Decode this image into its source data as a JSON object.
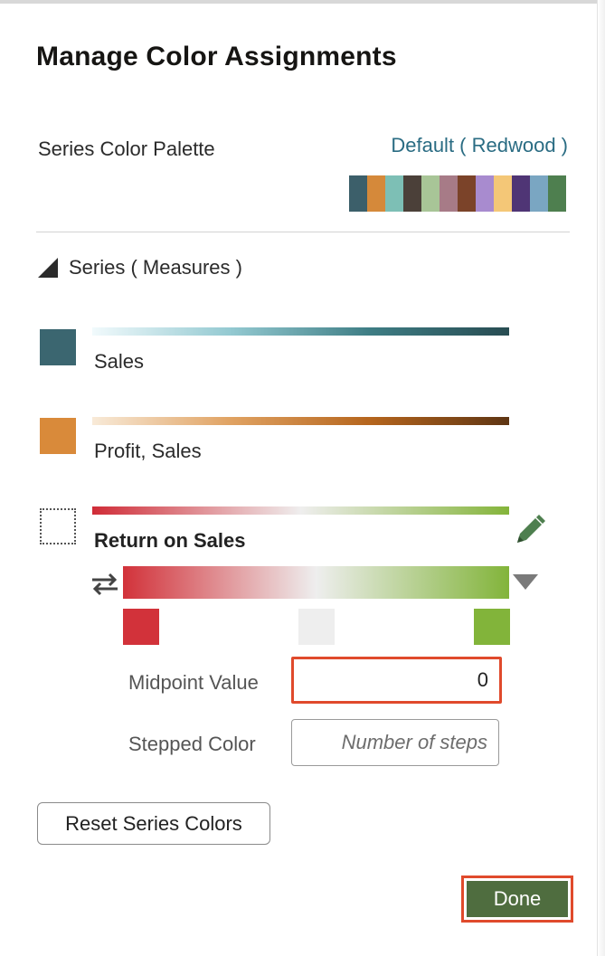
{
  "dialog": {
    "title": "Manage Color Assignments"
  },
  "palette": {
    "label": "Series Color Palette",
    "selected": "Default ( Redwood )",
    "swatch_colors": [
      "#3c5f6a",
      "#d5893a",
      "#7dbfb5",
      "#4b4039",
      "#a8c597",
      "#a77b87",
      "#7b4329",
      "#a88bcf",
      "#f4c777",
      "#4f3575",
      "#7aa6c2",
      "#4e7f4f"
    ]
  },
  "series_section": {
    "label": "Series ( Measures )"
  },
  "series": [
    {
      "name": "Sales",
      "swatch_color": "#3b6670",
      "ramp": [
        "#f1fafc",
        "#93c9d1",
        "#3e7d84",
        "#284c52"
      ]
    },
    {
      "name": "Profit, Sales",
      "swatch_color": "#d98a3a",
      "ramp": [
        "#f8ead8",
        "#e0a262",
        "#b5651d",
        "#5e3513"
      ]
    },
    {
      "name": "Return on Sales",
      "swatch_color": "",
      "ramp": [
        "#d02c37",
        "#efeeee",
        "#84b43a"
      ]
    }
  ],
  "diverging": {
    "colors": [
      "#d2323a",
      "#eeeeee",
      "#82b43a"
    ],
    "midpoint_label": "Midpoint Value",
    "midpoint_value": "0",
    "stepped_label": "Stepped Color",
    "steps_placeholder": "Number of steps"
  },
  "buttons": {
    "reset": "Reset Series Colors",
    "done": "Done"
  },
  "icons": {
    "collapse": "triangle-down-right-icon",
    "edit": "pencil-icon",
    "swap": "swap-arrows-icon",
    "dropdown": "caret-down-icon"
  }
}
